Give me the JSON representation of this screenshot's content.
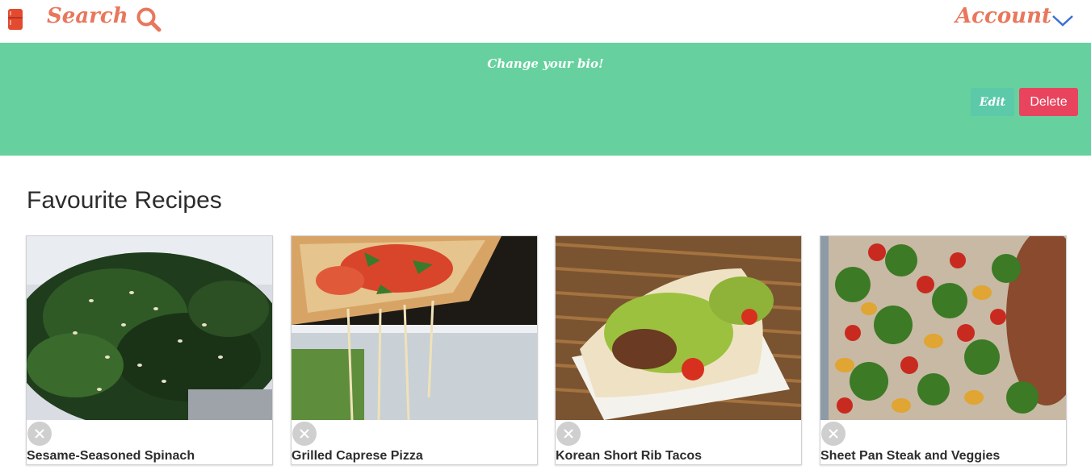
{
  "nav": {
    "logo_icon": "fridge-icon",
    "search_label": "Search",
    "search_icon": "search-icon",
    "account_label": "Account",
    "account_icon": "chevron-down-icon",
    "accent_color": "#e8775b"
  },
  "banner": {
    "bio_text": "Change your bio!",
    "edit_label": "Edit",
    "delete_label": "Delete",
    "background_color": "#66d19e",
    "delete_color": "#e9445e"
  },
  "favourites": {
    "title": "Favourite Recipes",
    "recipes": [
      {
        "title": "Sesame-Seasoned Spinach",
        "remove_icon": "close-icon"
      },
      {
        "title": "Grilled Caprese Pizza",
        "remove_icon": "close-icon"
      },
      {
        "title": "Korean Short Rib Tacos",
        "remove_icon": "close-icon"
      },
      {
        "title": "Sheet Pan Steak and Veggies",
        "remove_icon": "close-icon"
      }
    ]
  }
}
